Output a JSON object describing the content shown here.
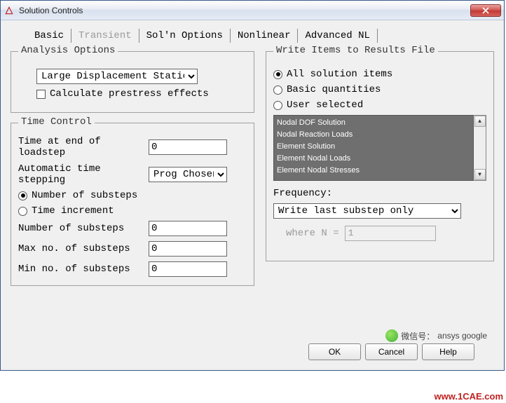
{
  "window": {
    "title": "Solution Controls"
  },
  "tabs": {
    "basic": "Basic",
    "transient": "Transient",
    "soln_options": "Sol'n Options",
    "nonlinear": "Nonlinear",
    "advanced_nl": "Advanced NL"
  },
  "analysis_options": {
    "legend": "Analysis Options",
    "type": "Large Displacement Static",
    "prestress_label": "Calculate prestress effects",
    "prestress_checked": false
  },
  "time_control": {
    "legend": "Time Control",
    "time_end_label": "Time at end of loadstep",
    "time_end_value": "0",
    "auto_ts_label": "Automatic time stepping",
    "auto_ts_value": "Prog Chosen",
    "mode_substeps_label": "Number of substeps",
    "mode_increment_label": "Time increment",
    "mode_selected": "substeps",
    "num_substeps_label": "Number of substeps",
    "num_substeps_value": "0",
    "max_substeps_label": "Max no. of substeps",
    "max_substeps_value": "0",
    "min_substeps_label": "Min no. of substeps",
    "min_substeps_value": "0"
  },
  "write_items": {
    "legend": "Write Items to Results File",
    "opt_all": "All solution items",
    "opt_basic": "Basic quantities",
    "opt_user": "User selected",
    "selected": "all",
    "list": [
      "Nodal DOF Solution",
      "Nodal Reaction Loads",
      "Element Solution",
      "Element Nodal Loads",
      "Element Nodal Stresses"
    ],
    "freq_label": "Frequency:",
    "freq_value": "Write last substep only",
    "where_label": "where N =",
    "where_value": "1"
  },
  "buttons": {
    "ok": "OK",
    "cancel": "Cancel",
    "help": "Help"
  },
  "footer": {
    "wechat_label": "微信号：",
    "wechat_id": "ansys google",
    "site": "www.1CAE.com"
  }
}
